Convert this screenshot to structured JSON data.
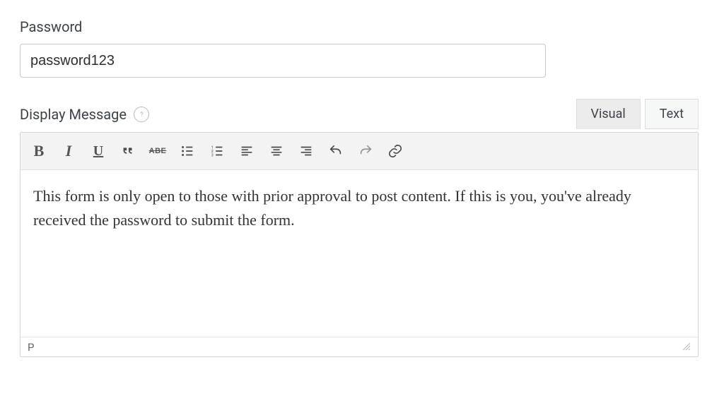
{
  "password": {
    "label": "Password",
    "value": "password123"
  },
  "display_message": {
    "label": "Display Message"
  },
  "tabs": {
    "visual": "Visual",
    "text": "Text"
  },
  "editor": {
    "content": "This form is only open to those with prior approval to post content. If this is you, you've already received the password to submit the form."
  },
  "statusbar": {
    "path": "P"
  }
}
